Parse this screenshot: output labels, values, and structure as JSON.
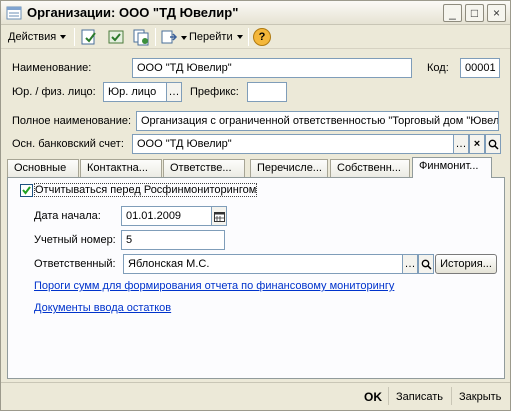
{
  "window": {
    "title": "Организации: ООО \"ТД Ювелир\"",
    "buttons": [
      "_",
      "□",
      "×"
    ]
  },
  "toolbar": {
    "actions_label": "Действия",
    "goto_label": "Перейти",
    "help_label": "?"
  },
  "form": {
    "name_label": "Наименование:",
    "name_value": "ООО \"ТД Ювелир\"",
    "code_label": "Код:",
    "code_value": "00001",
    "legal_label": "Юр. / физ. лицо:",
    "legal_value": "Юр. лицо",
    "prefix_label": "Префикс:",
    "prefix_value": "",
    "fullname_label": "Полное наименование:",
    "fullname_value": "Организация с ограниченной ответственностью \"Торговый дом \"Ювелир\"",
    "bank_label": "Осн. банковский счет:",
    "bank_value": "ООО \"ТД Ювелир\""
  },
  "tabs": [
    "Основные",
    "Контактна...",
    "Ответстве...",
    "Перечисле...",
    "Собственн...",
    "Финмонит..."
  ],
  "panel": {
    "report_checkbox_label": "Отчитываться перед Росфинмониторингом",
    "report_checked": true,
    "start_date_label": "Дата начала:",
    "start_date_value": "01.01.2009",
    "account_number_label": "Учетный номер:",
    "account_number_value": "5",
    "responsible_label": "Ответственный:",
    "responsible_value": "Яблонская М.С.",
    "history_label": "История...",
    "link_thresholds": "Пороги сумм для формирования отчета по финансовому мониторингу",
    "link_opening_balances": "Документы ввода остатков"
  },
  "footer": {
    "ok_label": "OK",
    "save_label": "Записать",
    "close_label": "Закрыть"
  }
}
